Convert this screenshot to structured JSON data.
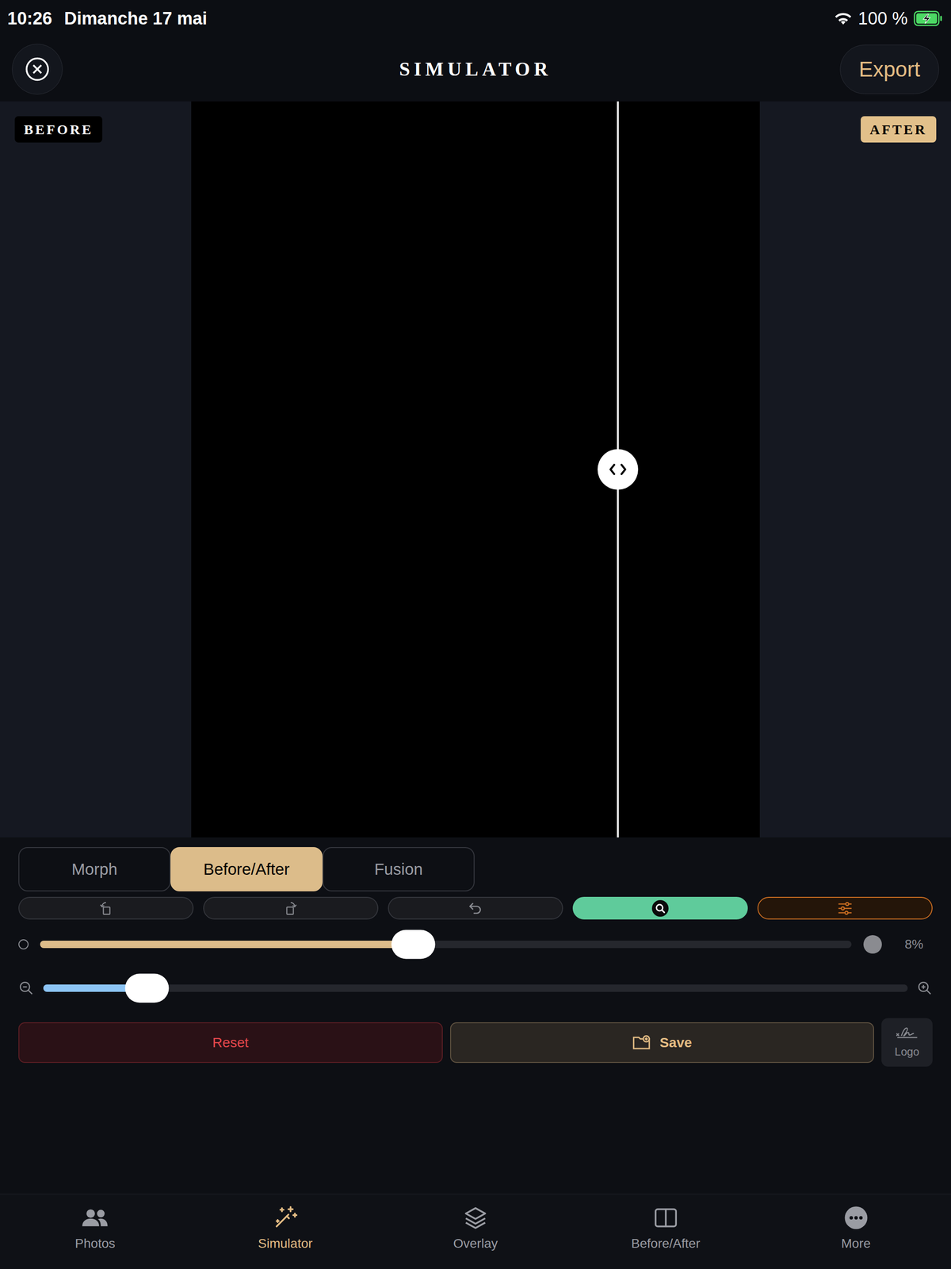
{
  "status_bar": {
    "time": "10:26",
    "date": "Dimanche 17 mai",
    "battery": "100 %",
    "charging": true
  },
  "header": {
    "title": "SIMULATOR",
    "export": "Export"
  },
  "comparison": {
    "before_label": "BEFORE",
    "after_label": "AFTER",
    "split": {
      "level": 0.75
    }
  },
  "modes": [
    {
      "label": "Morph",
      "selected": false
    },
    {
      "label": "Before/After",
      "selected": true
    },
    {
      "label": "Fusion",
      "selected": false
    }
  ],
  "tools": [
    {
      "kind": "rotate-left",
      "active": false,
      "color": "#34363c"
    },
    {
      "kind": "rotate-right",
      "active": false,
      "color": "#34363c"
    },
    {
      "kind": "undo",
      "active": false,
      "color": "#34363c"
    },
    {
      "kind": "search",
      "active": true,
      "color": "#5fcb9b"
    },
    {
      "kind": "adjust",
      "active": false,
      "color": "#c96d22"
    }
  ],
  "opacity_slider": {
    "level": 0.46,
    "reading": "8%"
  },
  "zoom_slider": {
    "level": 0.12
  },
  "actions": {
    "reset": "Reset",
    "save": "Save",
    "logo": "Logo"
  },
  "nav": [
    {
      "kind": "photos",
      "label": "Photos",
      "selected": false
    },
    {
      "kind": "simulator",
      "label": "Simulator",
      "selected": true
    },
    {
      "kind": "overlay",
      "label": "Overlay",
      "selected": false
    },
    {
      "kind": "before-after",
      "label": "Before/After",
      "selected": false
    },
    {
      "kind": "more",
      "label": "More",
      "selected": false
    }
  ]
}
